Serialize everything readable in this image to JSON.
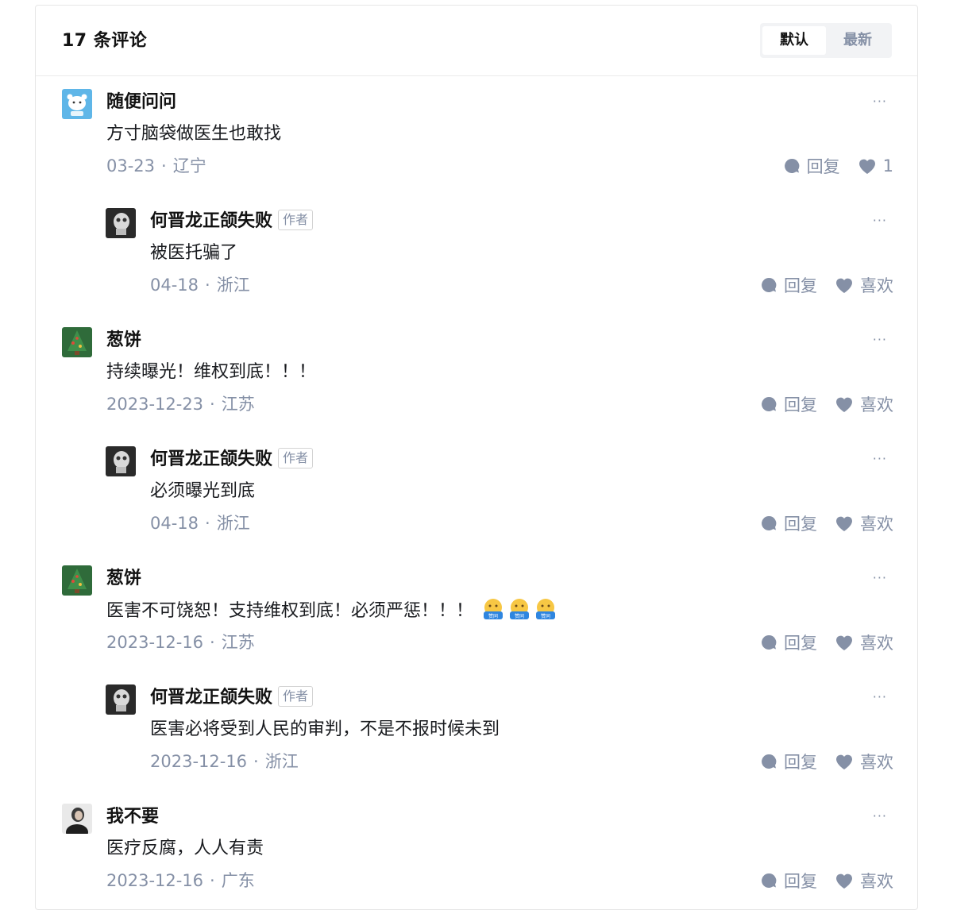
{
  "header": {
    "count_title": "17 条评论",
    "sort_default": "默认",
    "sort_latest": "最新"
  },
  "more_label": "···",
  "author_badge": "作者",
  "comments": [
    {
      "author": "随便问问",
      "content": "方寸脑袋做医生也敢找",
      "date": "03-23",
      "region": "辽宁",
      "reply": "回复",
      "like": "1",
      "avatar": "bear"
    },
    {
      "author": "何晋龙正颌失败",
      "content": "被医托骗了",
      "date": "04-18",
      "region": "浙江",
      "reply": "回复",
      "like": "喜欢",
      "avatar": "skull"
    },
    {
      "author": "葱饼",
      "content": "持续曝光！维权到底！！！",
      "date": "2023-12-23",
      "region": "江苏",
      "reply": "回复",
      "like": "喜欢",
      "avatar": "tree"
    },
    {
      "author": "何晋龙正颌失败",
      "content": "必须曝光到底",
      "date": "04-18",
      "region": "浙江",
      "reply": "回复",
      "like": "喜欢",
      "avatar": "skull"
    },
    {
      "author": "葱饼",
      "content": "医害不可饶恕！支持维权到底！必须严惩！！！",
      "date": "2023-12-16",
      "region": "江苏",
      "reply": "回复",
      "like": "喜欢",
      "avatar": "tree",
      "emoji_label": "赞同"
    },
    {
      "author": "何晋龙正颌失败",
      "content": "医害必将受到人民的审判，不是不报时候未到",
      "date": "2023-12-16",
      "region": "浙江",
      "reply": "回复",
      "like": "喜欢",
      "avatar": "skull"
    },
    {
      "author": "我不要",
      "content": "医疗反腐，人人有责",
      "date": "2023-12-16",
      "region": "广东",
      "reply": "回复",
      "like": "喜欢",
      "avatar": "person"
    }
  ],
  "colors": {
    "muted": "#8590a6",
    "text": "#121212",
    "border": "#ebebeb",
    "switch_bg": "#f2f3f5"
  }
}
